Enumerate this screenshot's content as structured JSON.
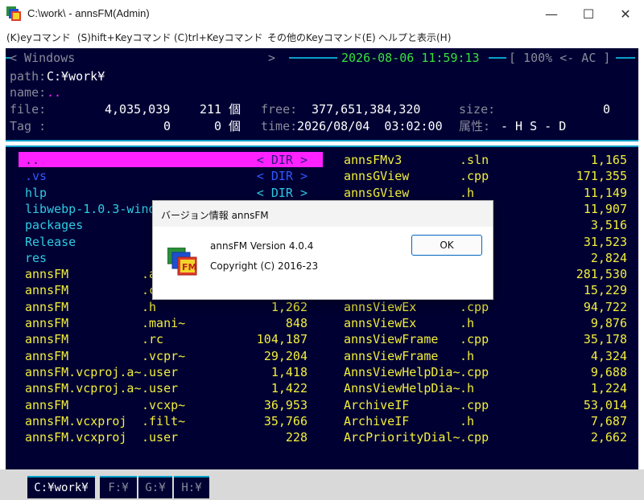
{
  "window": {
    "title": "C:\\work\\ - annsFM(Admin)",
    "minimize": "—",
    "maximize": "☐",
    "close": "✕"
  },
  "menu": [
    "(K)eyコマンド",
    "(S)hift+Keyコマンド",
    "(C)trl+Keyコマンド",
    "その他のKeyコマンド(E)",
    "ヘルプと表示(H)"
  ],
  "header": {
    "windows_left": "< Windows",
    "windows_right": ">",
    "datetime": "2026-08-06 11:59:13",
    "zoom": "[ 100% <- AC ]",
    "path_label": "path:",
    "path_value": "C:¥work¥",
    "name_label": "name:",
    "name_value": "..",
    "file_label": "file:",
    "file_bytes": "4,035,039",
    "file_count": "211 個",
    "free_label": "free:",
    "free_value": "377,651,384,320",
    "size_label": "size:",
    "size_value": "0",
    "tag_label": "Tag :",
    "tag_bytes": "0",
    "tag_count": "0 個",
    "time_label": "time:",
    "time_value": "2026/08/04  03:02:00",
    "attr_label": "属性:",
    "attr_value": "- H S - D"
  },
  "left_list": [
    {
      "name": "..",
      "ext": "",
      "size": "< DIR >",
      "color": "#ff22ff"
    },
    {
      "name": ".vs",
      "ext": "",
      "size": "< DIR >",
      "color": "#2f57ff"
    },
    {
      "name": "hlp",
      "ext": "",
      "size": "< DIR >",
      "color": "#2ecbe3"
    },
    {
      "name": "libwebp-1.0.3-wind",
      "ext": "",
      "size": "",
      "color": "#2ecbe3"
    },
    {
      "name": "packages",
      "ext": "",
      "size": "",
      "color": "#2ecbe3"
    },
    {
      "name": "Release",
      "ext": "",
      "size": "",
      "color": "#2ecbe3"
    },
    {
      "name": "res",
      "ext": "",
      "size": "",
      "color": "#2ecbe3"
    },
    {
      "name": "annsFM",
      "ext": ".a",
      "size": "",
      "color": "#f2ef3a"
    },
    {
      "name": "annsFM",
      "ext": ".c",
      "size": "",
      "color": "#f2ef3a"
    },
    {
      "name": "annsFM",
      "ext": ".h",
      "size": "1,262",
      "color": "#f2ef3a"
    },
    {
      "name": "annsFM",
      "ext": ".mani~",
      "size": "848",
      "color": "#f2ef3a"
    },
    {
      "name": "annsFM",
      "ext": ".rc",
      "size": "104,187",
      "color": "#f2ef3a"
    },
    {
      "name": "annsFM",
      "ext": ".vcpr~",
      "size": "29,204",
      "color": "#f2ef3a"
    },
    {
      "name": "annsFM.vcproj.a~",
      "ext": ".user",
      "size": "1,418",
      "color": "#f2ef3a"
    },
    {
      "name": "annsFM.vcproj.a~",
      "ext": ".user",
      "size": "1,422",
      "color": "#f2ef3a"
    },
    {
      "name": "annsFM",
      "ext": ".vcxp~",
      "size": "36,953",
      "color": "#f2ef3a"
    },
    {
      "name": "annsFM.vcxproj",
      "ext": ".filt~",
      "size": "35,766",
      "color": "#f2ef3a"
    },
    {
      "name": "annsFM.vcxproj",
      "ext": ".user",
      "size": "228",
      "color": "#f2ef3a"
    }
  ],
  "right_list": [
    {
      "name": "annsFMv3",
      "ext": ".sln",
      "size": "1,165"
    },
    {
      "name": "annsGView",
      "ext": ".cpp",
      "size": "171,355"
    },
    {
      "name": "annsGView",
      "ext": ".h",
      "size": "11,149"
    },
    {
      "name": "",
      "ext": "",
      "size": "11,907"
    },
    {
      "name": "",
      "ext": "",
      "size": "3,516"
    },
    {
      "name": "",
      "ext": "",
      "size": "31,523"
    },
    {
      "name": "",
      "ext": "",
      "size": "2,824"
    },
    {
      "name": "",
      "ext": "",
      "size": "281,530"
    },
    {
      "name": "",
      "ext": "",
      "size": "15,229"
    },
    {
      "name": "annsViewEx",
      "ext": ".cpp",
      "size": "94,722"
    },
    {
      "name": "annsViewEx",
      "ext": ".h",
      "size": "9,876"
    },
    {
      "name": "annsViewFrame",
      "ext": ".cpp",
      "size": "35,178"
    },
    {
      "name": "annsViewFrame",
      "ext": ".h",
      "size": "4,324"
    },
    {
      "name": "AnnsViewHelpDia~",
      "ext": ".cpp",
      "size": "9,688"
    },
    {
      "name": "AnnsViewHelpDia~",
      "ext": ".h",
      "size": "1,224"
    },
    {
      "name": "ArchiveIF",
      "ext": ".cpp",
      "size": "53,014"
    },
    {
      "name": "ArchiveIF",
      "ext": ".h",
      "size": "7,687"
    },
    {
      "name": "ArcPriorityDial~",
      "ext": ".cpp",
      "size": "2,662"
    }
  ],
  "tabs": [
    {
      "label": "C:¥work¥",
      "active": true
    },
    {
      "label": "F:¥",
      "active": false
    },
    {
      "label": "G:¥",
      "active": false
    },
    {
      "label": "H:¥",
      "active": false
    }
  ],
  "dialog": {
    "title": "バージョン情報 annsFM",
    "version": "annsFM Version 4.0.4",
    "copyright": "Copyright (C) 2016-23",
    "ok_label": "OK"
  }
}
